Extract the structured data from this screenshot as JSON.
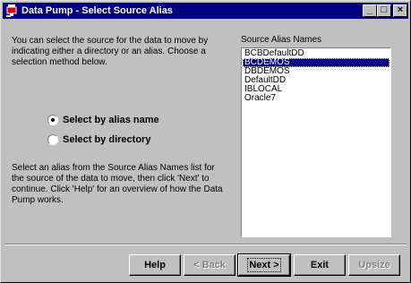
{
  "window": {
    "title": "Data Pump - Select Source Alias"
  },
  "titlebar_buttons": {
    "minimize": "_",
    "maximize": "□",
    "close": "×"
  },
  "intro_text": "You can select the source for the data to move by indicating either a directory or an alias. Choose a selection method below.",
  "options": [
    {
      "label": "Select by alias name",
      "selected": true
    },
    {
      "label": "Select by directory",
      "selected": false
    }
  ],
  "help_text": "Select an alias from the Source Alias Names list for the source of the data to move, then click 'Next' to continue. Click 'Help' for an overview of how the Data Pump works.",
  "alias_list": {
    "caption": "Source Alias Names",
    "items": [
      "BCBDefaultDD",
      "BCDEMOS",
      "DBDEMOS",
      "DefaultDD",
      "IBLOCAL",
      "Oracle7"
    ],
    "selected_index": 1
  },
  "buttons": {
    "help": "Help",
    "back": "< Back",
    "next": "Next >",
    "exit": "Exit",
    "upsize": "Upsize"
  },
  "colors": {
    "titlebar": "#000080",
    "face": "#c0c0c0",
    "selection": "#000080"
  },
  "icons": {
    "app": "data-pump-icon"
  }
}
